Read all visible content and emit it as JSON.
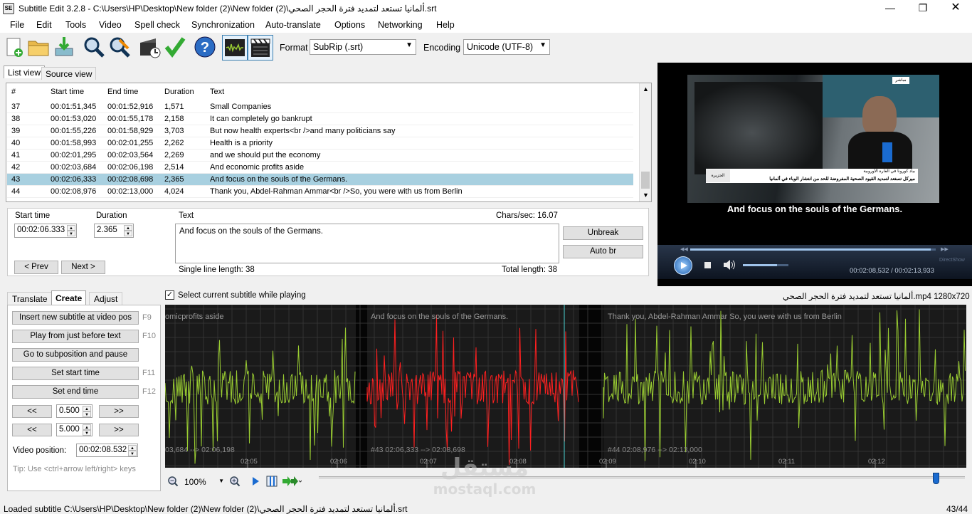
{
  "window": {
    "title": "Subtitle Edit 3.2.8 - C:\\Users\\HP\\Desktop\\New folder (2)\\New folder (2)\\ألمانيا تستعد لتمديد فترة الحجر الصحي.srt",
    "icon_text": "SE"
  },
  "menu": [
    "File",
    "Edit",
    "Tools",
    "Video",
    "Spell check",
    "Synchronization",
    "Auto-translate",
    "Options",
    "Networking",
    "Help"
  ],
  "toolbar": {
    "format_label": "Format",
    "format_value": "SubRip (.srt)",
    "encoding_label": "Encoding",
    "encoding_value": "Unicode (UTF-8)",
    "icons": [
      "new-file-icon",
      "open-folder-icon",
      "save-download-icon",
      "find-icon",
      "replace-icon",
      "visual-sync-icon",
      "spell-check-icon",
      "help-icon",
      "waveform-toggle-icon",
      "video-toggle-icon"
    ]
  },
  "view_tabs": [
    "List view",
    "Source view"
  ],
  "grid": {
    "headers": [
      "#",
      "Start time",
      "End time",
      "Duration",
      "Text"
    ],
    "selected_index": 6,
    "rows": [
      {
        "n": "37",
        "start": "00:01:51,345",
        "end": "00:01:52,916",
        "dur": "1,571",
        "text": "Small  Companies"
      },
      {
        "n": "38",
        "start": "00:01:53,020",
        "end": "00:01:55,178",
        "dur": "2,158",
        "text": "It can completely go bankrupt"
      },
      {
        "n": "39",
        "start": "00:01:55,226",
        "end": "00:01:58,929",
        "dur": "3,703",
        "text": "But now health experts<br />and many politicians say"
      },
      {
        "n": "40",
        "start": "00:01:58,993",
        "end": "00:02:01,255",
        "dur": "2,262",
        "text": "Health is a priority"
      },
      {
        "n": "41",
        "start": "00:02:01,295",
        "end": "00:02:03,564",
        "dur": "2,269",
        "text": "and we should put the economy"
      },
      {
        "n": "42",
        "start": "00:02:03,684",
        "end": "00:02:06,198",
        "dur": "2,514",
        "text": "And economic profits aside"
      },
      {
        "n": "43",
        "start": "00:02:06,333",
        "end": "00:02:08,698",
        "dur": "2,365",
        "text": "And focus on the souls of the Germans."
      },
      {
        "n": "44",
        "start": "00:02:08,976",
        "end": "00:02:13,000",
        "dur": "4,024",
        "text": "Thank you, Abdel-Rahman Ammar<br />So, you were with us from Berlin"
      }
    ]
  },
  "editor": {
    "start_label": "Start time",
    "start_value": "00:02:06.333",
    "duration_label": "Duration",
    "duration_value": "2.365",
    "text_label": "Text",
    "chars_sec": "Chars/sec: 16.07",
    "text_value": "And focus on the souls of the Germans.",
    "single_line": "Single line length: 38",
    "total_length": "Total length: 38",
    "prev": "< Prev",
    "next": "Next >",
    "unbreak": "Unbreak",
    "auto_br": "Auto br"
  },
  "video": {
    "subtitle": "And focus on the souls of the Germans.",
    "time": "00:02:08,532 / 00:02:13,933",
    "watermark": "DirectShow",
    "banner_line1": "بياد كورونا في القارة الأوروبية",
    "banner_line2": "ميركل تستعد لتمديد القيود الصحية المفروضة للحد من انتشار الوباء في ألمانيا",
    "channel": "الجزيرة",
    "corner_label": "مباشر"
  },
  "bottom_tabs": [
    "Translate",
    "Create",
    "Adjust"
  ],
  "create": {
    "buttons": [
      {
        "label": "Insert new subtitle at video pos",
        "key": "F9"
      },
      {
        "label": "Play from just before text",
        "key": "F10"
      },
      {
        "label": "Go to subposition and pause",
        "key": ""
      },
      {
        "label": "Set start time",
        "key": "F11"
      },
      {
        "label": "Set end time",
        "key": "F12"
      }
    ],
    "back": "<<",
    "fwd": ">>",
    "step1": "0.500",
    "step2": "5.000",
    "video_pos_label": "Video position:",
    "video_pos_value": "00:02:08.532",
    "tip": "Tip: Use <ctrl+arrow left/right> keys"
  },
  "waveform": {
    "select_label": "Select current subtitle while playing",
    "file_info": "ألمانيا تستعد لتمديد فترة الحجر الصحي.mp4 1280x720",
    "segments": [
      {
        "text": "omicprofits aside",
        "time": "03,684 --> 02:06,198"
      },
      {
        "text": "And focus on the souls of the Germans.",
        "time": "#43  02:06,333 --> 02:08,698"
      },
      {
        "text": "Thank you, Abdel-Rahman Ammar  So, you were with us from Berlin",
        "time": "#44  02:08,976 --> 02:13,000"
      }
    ],
    "ticks": [
      "02:05",
      "02:06",
      "02:07",
      "02:08",
      "02:09",
      "02:10",
      "02:11",
      "02:12"
    ],
    "zoom": "100%",
    "colors": {
      "normal": "#9acd32",
      "selected": "#ff2020",
      "bg": "#1a1a1a",
      "grid": "#333333"
    }
  },
  "status": {
    "left": "Loaded subtitle C:\\Users\\HP\\Desktop\\New folder (2)\\New folder (2)\\ألمانيا تستعد لتمديد فترة الحجر الصحي.srt",
    "right": "43/44"
  },
  "logo_watermark": {
    "arabic": "مستقل",
    "latin": "mostaql.com"
  }
}
